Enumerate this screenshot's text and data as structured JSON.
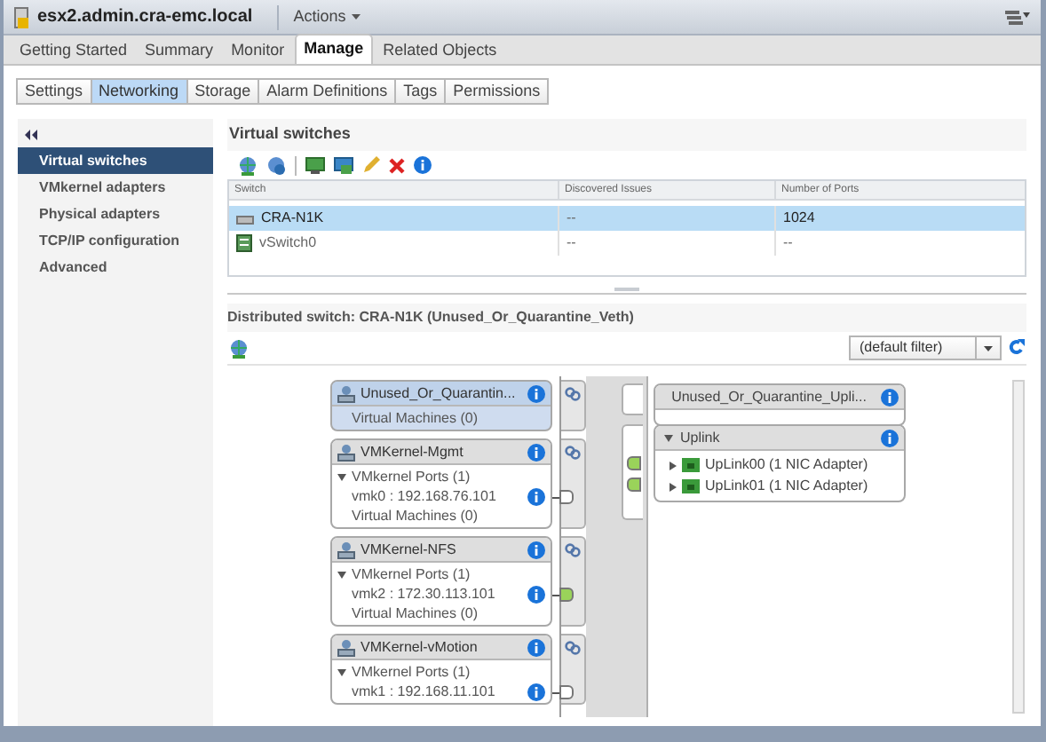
{
  "window": {
    "title": "esx2.admin.cra-emc.local",
    "actions": "Actions"
  },
  "tabs": [
    {
      "label": "Getting Started",
      "selected": false
    },
    {
      "label": "Summary",
      "selected": false
    },
    {
      "label": "Monitor",
      "selected": false
    },
    {
      "label": "Manage",
      "selected": true
    },
    {
      "label": "Related Objects",
      "selected": false
    }
  ],
  "subtabs": [
    {
      "label": "Settings",
      "selected": false
    },
    {
      "label": "Networking",
      "selected": true
    },
    {
      "label": "Storage",
      "selected": false
    },
    {
      "label": "Alarm Definitions",
      "selected": false
    },
    {
      "label": "Tags",
      "selected": false
    },
    {
      "label": "Permissions",
      "selected": false
    }
  ],
  "sidebar": {
    "items": [
      {
        "label": "Virtual switches",
        "selected": true
      },
      {
        "label": "VMkernel adapters",
        "selected": false
      },
      {
        "label": "Physical adapters",
        "selected": false
      },
      {
        "label": "TCP/IP configuration",
        "selected": false
      },
      {
        "label": "Advanced",
        "selected": false
      }
    ]
  },
  "virtual_switches": {
    "title": "Virtual switches",
    "table": {
      "columns": [
        "Switch",
        "Discovered Issues",
        "Number of Ports"
      ],
      "rows": [
        {
          "kind": "distributed",
          "selected": true,
          "cells": [
            "CRA-N1K",
            "--",
            "1024"
          ]
        },
        {
          "kind": "standard",
          "selected": false,
          "cells": [
            "vSwitch0",
            "--",
            "--"
          ]
        }
      ]
    }
  },
  "distributed_switch": {
    "title": "Distributed switch: CRA-N1K (Unused_Or_Quarantine_Veth)",
    "filter": "(default filter)",
    "port_groups": [
      {
        "name": "Unused_Or_Quarantin...",
        "selected": true,
        "vms": "Virtual Machines (0)"
      },
      {
        "name": "VMKernel-Mgmt",
        "selected": false,
        "expanded": true,
        "ports_label": "VMkernel Ports (1)",
        "ports": [
          {
            "label": "vmk0 : 192.168.76.101",
            "connected": false
          }
        ],
        "vms": "Virtual Machines (0)"
      },
      {
        "name": "VMKernel-NFS",
        "selected": false,
        "expanded": true,
        "ports_label": "VMkernel Ports (1)",
        "ports": [
          {
            "label": "vmk2 : 172.30.113.101",
            "connected": true
          }
        ],
        "vms": "Virtual Machines (0)"
      },
      {
        "name": "VMKernel-vMotion",
        "selected": false,
        "expanded": true,
        "ports_label": "VMkernel Ports (1)",
        "ports": [
          {
            "label": "vmk1 : 192.168.11.101",
            "connected": false
          }
        ]
      }
    ],
    "uplink_groups": [
      {
        "name": "Unused_Or_Quarantine_Upli..."
      },
      {
        "name": "Uplink",
        "expanded": true,
        "uplinks": [
          {
            "label": "UpLink00 (1 NIC Adapter)",
            "expanded": false
          },
          {
            "label": "UpLink01 (1 NIC Adapter)",
            "expanded": false
          }
        ]
      }
    ]
  }
}
